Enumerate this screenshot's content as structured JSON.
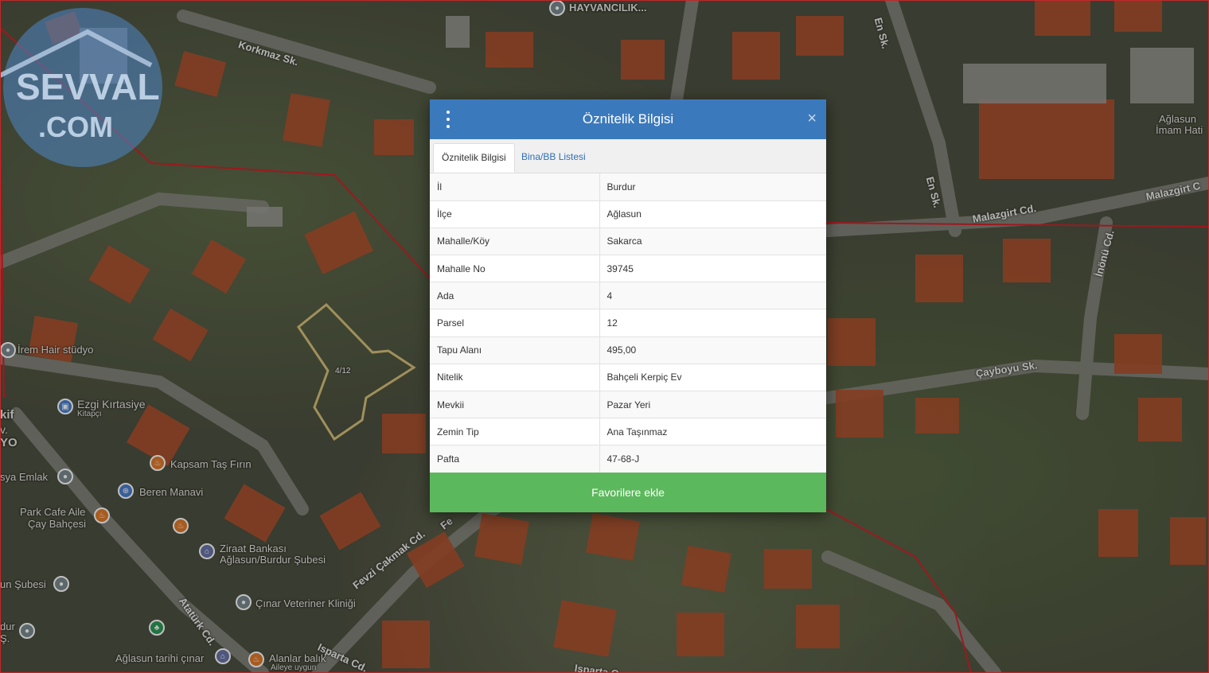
{
  "modal": {
    "title": "Öznitelik Bilgisi",
    "tabs": [
      {
        "label": "Öznitelik Bilgisi",
        "active": true
      },
      {
        "label": "Bina/BB Listesi",
        "active": false
      }
    ],
    "rows": [
      {
        "key": "İl",
        "value": "Burdur"
      },
      {
        "key": "İlçe",
        "value": "Ağlasun"
      },
      {
        "key": "Mahalle/Köy",
        "value": "Sakarca"
      },
      {
        "key": "Mahalle No",
        "value": "39745"
      },
      {
        "key": "Ada",
        "value": "4"
      },
      {
        "key": "Parsel",
        "value": "12"
      },
      {
        "key": "Tapu Alanı",
        "value": "495,00"
      },
      {
        "key": "Nitelik",
        "value": "Bahçeli Kerpiç Ev"
      },
      {
        "key": "Mevkii",
        "value": "Pazar Yeri"
      },
      {
        "key": "Zemin Tip",
        "value": "Ana Taşınmaz"
      },
      {
        "key": "Pafta",
        "value": "47-68-J"
      }
    ],
    "favorite_button": "Favorilere ekle",
    "close_symbol": "×"
  },
  "map": {
    "parcel_label": "4/12",
    "streets": {
      "korkmaz": "Korkmaz Sk.",
      "malazgirt": "Malazgirt Cd.",
      "malazgirt2": "Malazgirt C",
      "en": "En Sk.",
      "en_top": "En Sk.",
      "cayboyu": "Çayboyu Sk.",
      "inonu": "İnönü Cd.",
      "fevzi": "Fevzi Çakmak Cd.",
      "fevzi2": "Fe",
      "ataturk": "Atatürk Cd.",
      "isparta": "Isparta Cd.",
      "isparta2": "Isparta C"
    },
    "pois": {
      "irem": "İrem Hair stüdyo",
      "ezgi": "Ezgi Kırtasiye",
      "ezgi_sub": "Kitapçı",
      "kapsam": "Kapsam Taş Fırın",
      "beren": "Beren Manavi",
      "park_cafe_1": "Park Cafe Aile",
      "park_cafe_2": "Çay Bahçesi",
      "ziraat_1": "Ziraat Bankası",
      "ziraat_2": "Ağlasun/Burdur Şubesi",
      "cinar": "Çınar Veteriner Kliniği",
      "aglasun_cinar": "Ağlasun tarihi çınar",
      "alanlar": "Alanlar balık",
      "alanlar_sub": "Aileye uygun",
      "emlak": "sya Emlak",
      "subesi": "un Şubesi",
      "hayvancilik": "HAYVANCILIK...",
      "imam_1": "Ağlasun",
      "imam_2": "İmam Hati",
      "akif": "kif",
      "akif_2": "v.",
      "akif_3": "YO",
      "dur": "dur",
      "dur_2": "Ş."
    }
  },
  "watermark": {
    "line1": "SEVVAL",
    "line2": ".COM"
  }
}
